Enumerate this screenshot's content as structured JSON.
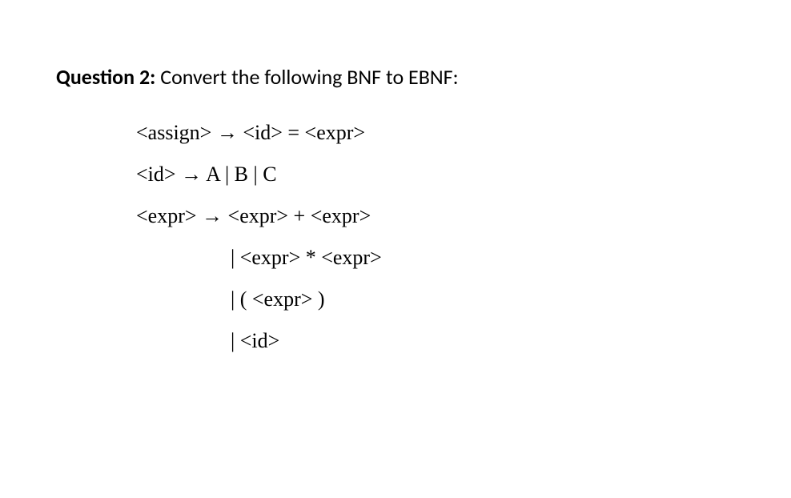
{
  "header": {
    "label": "Question 2:",
    "prompt": " Convert the following BNF to EBNF:"
  },
  "grammar": {
    "rule1": "<assign> → <id> = <expr>",
    "rule2": "<id> → A | B | C",
    "rule3": "<expr> → <expr> + <expr>",
    "rule3_alt1": "| <expr> * <expr>",
    "rule3_alt2": "| ( <expr> )",
    "rule3_alt3": "| <id>"
  }
}
